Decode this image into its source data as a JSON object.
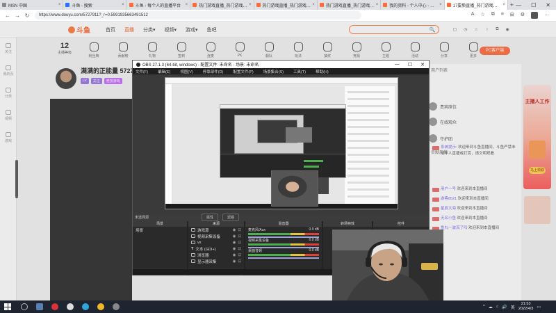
{
  "browser": {
    "tabs": [
      {
        "label": "MSN 中国",
        "color": "#333333"
      },
      {
        "label": "斗鱼 - 搜索",
        "color": "#2b6fff"
      },
      {
        "label": "斗鱼 - 每个人的直播平台",
        "color": "#ff6a3d"
      },
      {
        "label": "热门游戏直播_热门游戏视频_热",
        "color": "#ff6a3d"
      },
      {
        "label": "热门游戏直播_热门游戏视频_热",
        "color": "#ff6a3d"
      },
      {
        "label": "热门游戏直播_热门游戏视频_热",
        "color": "#ff6a3d"
      },
      {
        "label": "我的资料 - 个人中心 - 斗鱼",
        "color": "#ff6a3d"
      },
      {
        "label": "17要质直播_热门游戏直播_斗鱼直",
        "color": "#ff6a3d",
        "active": true
      }
    ],
    "url": "https://www.douyu.com/5727911?_r=0.5991935663491512",
    "min": "—",
    "max": "☐",
    "close": "✕",
    "newtab": "+"
  },
  "douyu": {
    "logo": "斗鱼",
    "nav": [
      "首页",
      "直播",
      "分类▾",
      "视频▾",
      "游戏▾",
      "鱼吧"
    ],
    "search_icon": "🔍",
    "header_icons": [
      "▢",
      "◷",
      "☆",
      "♢",
      "⧉",
      "◉"
    ],
    "left_rail": [
      "关注",
      "我的页",
      "分类",
      "视频",
      "游戏"
    ],
    "icon_row": {
      "count": "12",
      "count_label": "主播等级",
      "tiles": [
        "粉丝牌",
        "贡献榜",
        "礼物",
        "签到",
        "连麦",
        "PK",
        "舰队",
        "玩法",
        "抽奖",
        "竞猜",
        "主题",
        "活动",
        "分享",
        "更多",
        "举报"
      ]
    },
    "pc_button": "PC客户端",
    "anchor": {
      "name": "满满的正能量 5727911",
      "badges": [
        "LV",
        "关注",
        "竞技游戏"
      ]
    },
    "right_panel": {
      "lines": [
        "用户列表",
        "贡献周榜"
      ],
      "rows": [
        "贵宾席位",
        "在线观众",
        "守护团"
      ]
    },
    "chat": [
      {
        "user": "系统提示:",
        "msg": "欢迎来到斗鱼直播间，斗鱼严禁未成年人直播或打赏，请文明观看"
      },
      {
        "user": "用户一号",
        "msg": "欢迎来到本直播间"
      },
      {
        "user": "游客8521",
        "msg": "欢迎来到本直播间"
      },
      {
        "user": "星辰大海",
        "msg": "欢迎来到本直播间"
      },
      {
        "user": "无名小鱼",
        "msg": "欢迎来到本直播间"
      },
      {
        "user": "鱼丸一波流了吗",
        "msg": "欢迎来到本直播间"
      }
    ],
    "promo": {
      "title": "主播人工作",
      "button": "马上领取"
    }
  },
  "obs": {
    "title": "OBS 27.1.3 (64-bit, windows) - 配置文件: 未命名 - 场景: 未命名",
    "menu": [
      "文件(F)",
      "编辑(E)",
      "视图(V)",
      "停靠部件(D)",
      "配置文件(P)",
      "场景集合(S)",
      "工具(T)",
      "帮助(H)"
    ],
    "controls_bar": [
      "未选择源",
      "属性",
      "滤镜"
    ],
    "docks": {
      "scenes": {
        "title": "场景",
        "items": [
          "场景"
        ]
      },
      "sources": {
        "title": "来源",
        "items": [
          "游戏源",
          "视频采集设备",
          "vs",
          "文本 (GDI+)",
          "浏览器",
          "显示器采集"
        ]
      },
      "mixer": {
        "title": "混音器",
        "channels": [
          {
            "name": "麦克风/Aux",
            "db": "0.0 dB"
          },
          {
            "name": "视频采集设备",
            "db": "0.0 dB"
          },
          {
            "name": "桌面音频",
            "db": "0.0 dB"
          }
        ]
      },
      "transitions": {
        "title": "转场特效"
      },
      "controls": {
        "title": "控件"
      }
    },
    "status": "LIVE: 00:00:00  REC: 00:00:00  CPU: 12%  60.00 fps"
  },
  "taskbar": {
    "time": "21:53",
    "date": "2022/4/3",
    "apps": [
      {
        "name": "steam-icon",
        "color": "#5a7fb3"
      },
      {
        "name": "netease-music-icon",
        "color": "#d9323a"
      },
      {
        "name": "obs-icon",
        "color": "#dddddd"
      },
      {
        "name": "edge-icon",
        "color": "#30a6d8"
      },
      {
        "name": "chrome-icon",
        "color": "#f1b72b"
      },
      {
        "name": "obs-running-icon",
        "color": "#888888"
      }
    ],
    "tray": [
      "^",
      "☁",
      "⌂",
      "🔊",
      "英"
    ]
  }
}
